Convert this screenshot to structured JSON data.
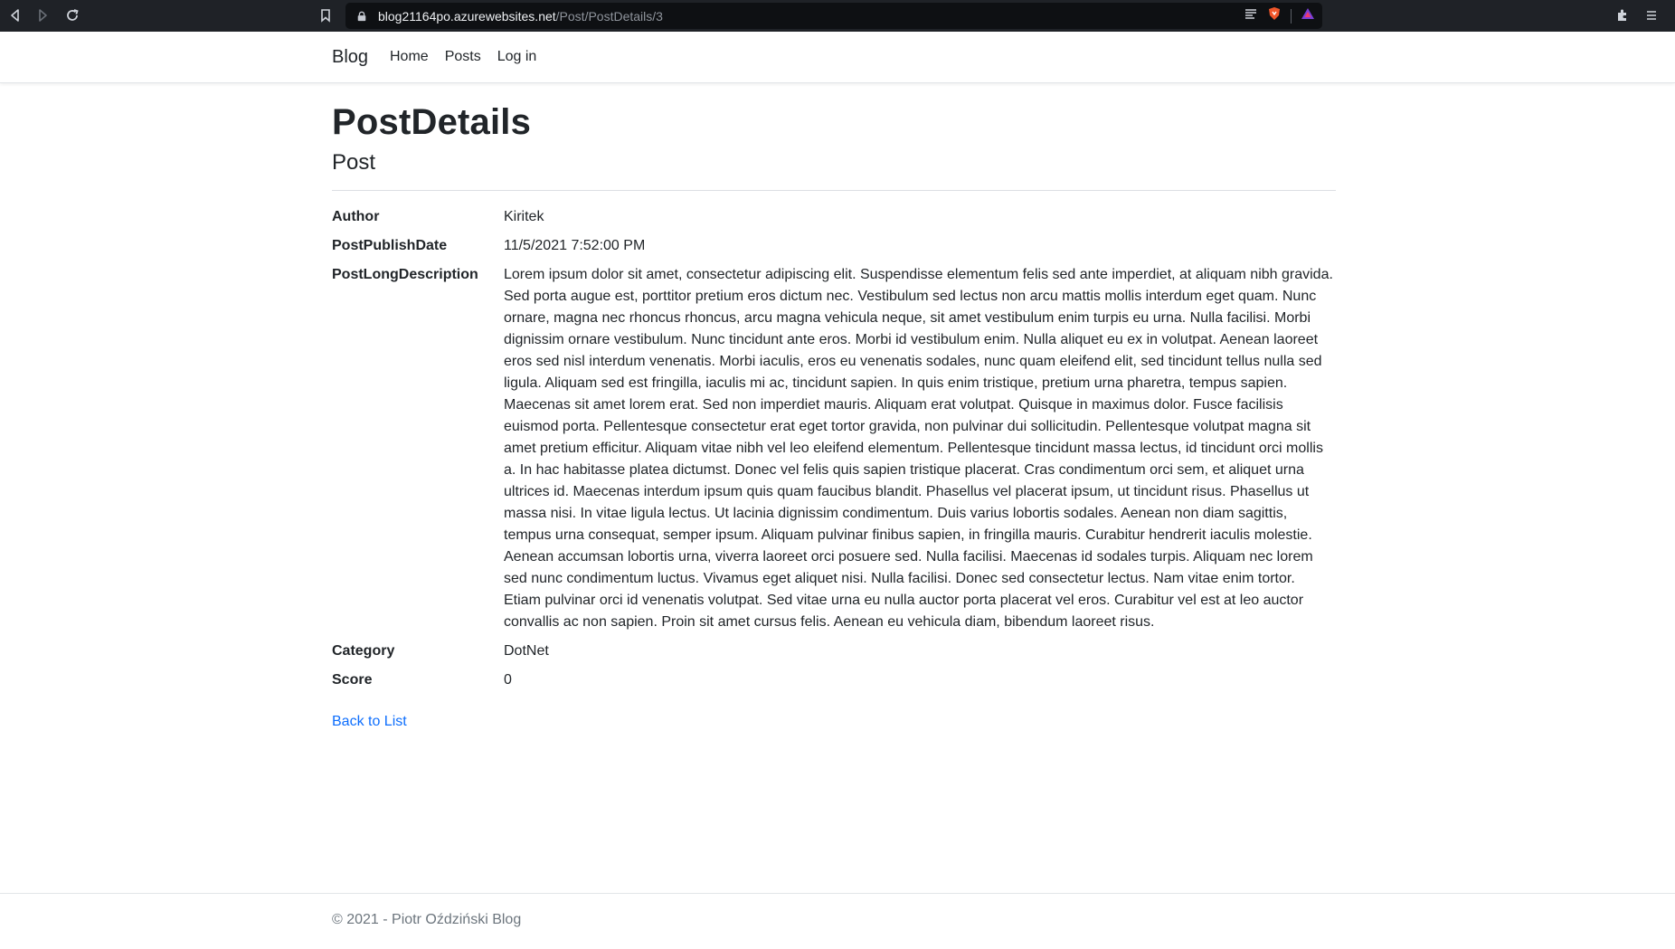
{
  "browser": {
    "url_host": "blog21164po.azurewebsites.net",
    "url_path": "/Post/PostDetails/3"
  },
  "navbar": {
    "brand": "Blog",
    "links": [
      "Home",
      "Posts",
      "Log in"
    ]
  },
  "page": {
    "title": "PostDetails",
    "subtitle": "Post"
  },
  "details": {
    "author_label": "Author",
    "author_value": "Kiritek",
    "date_label": "PostPublishDate",
    "date_value": "11/5/2021 7:52:00 PM",
    "desc_label": "PostLongDescription",
    "desc_value": "Lorem ipsum dolor sit amet, consectetur adipiscing elit. Suspendisse elementum felis sed ante imperdiet, at aliquam nibh gravida. Sed porta augue est, porttitor pretium eros dictum nec. Vestibulum sed lectus non arcu mattis mollis interdum eget quam. Nunc ornare, magna nec rhoncus rhoncus, arcu magna vehicula neque, sit amet vestibulum enim turpis eu urna. Nulla facilisi. Morbi dignissim ornare vestibulum. Nunc tincidunt ante eros. Morbi id vestibulum enim. Nulla aliquet eu ex in volutpat. Aenean laoreet eros sed nisl interdum venenatis. Morbi iaculis, eros eu venenatis sodales, nunc quam eleifend elit, sed tincidunt tellus nulla sed ligula. Aliquam sed est fringilla, iaculis mi ac, tincidunt sapien. In quis enim tristique, pretium urna pharetra, tempus sapien. Maecenas sit amet lorem erat. Sed non imperdiet mauris. Aliquam erat volutpat. Quisque in maximus dolor. Fusce facilisis euismod porta. Pellentesque consectetur erat eget tortor gravida, non pulvinar dui sollicitudin. Pellentesque volutpat magna sit amet pretium efficitur. Aliquam vitae nibh vel leo eleifend elementum. Pellentesque tincidunt massa lectus, id tincidunt orci mollis a. In hac habitasse platea dictumst. Donec vel felis quis sapien tristique placerat. Cras condimentum orci sem, et aliquet urna ultrices id. Maecenas interdum ipsum quis quam faucibus blandit. Phasellus vel placerat ipsum, ut tincidunt risus. Phasellus ut massa nisi. In vitae ligula lectus. Ut lacinia dignissim condimentum. Duis varius lobortis sodales. Aenean non diam sagittis, tempus urna consequat, semper ipsum. Aliquam pulvinar finibus sapien, in fringilla mauris. Curabitur hendrerit iaculis molestie. Aenean accumsan lobortis urna, viverra laoreet orci posuere sed. Nulla facilisi. Maecenas id sodales turpis. Aliquam nec lorem sed nunc condimentum luctus. Vivamus eget aliquet nisi. Nulla facilisi. Donec sed consectetur lectus. Nam vitae enim tortor. Etiam pulvinar orci id venenatis volutpat. Sed vitae urna eu nulla auctor porta placerat vel eros. Curabitur vel est at leo auctor convallis ac non sapien. Proin sit amet cursus felis. Aenean eu vehicula diam, bibendum laoreet risus.",
    "category_label": "Category",
    "category_value": "DotNet",
    "score_label": "Score",
    "score_value": "0"
  },
  "back_link": "Back to List",
  "footer": {
    "text": "© 2021 - Piotr Oździński Blog"
  },
  "colors": {
    "link": "#0d6efd",
    "muted": "#6c757d",
    "browser_bar": "#1f2227"
  }
}
